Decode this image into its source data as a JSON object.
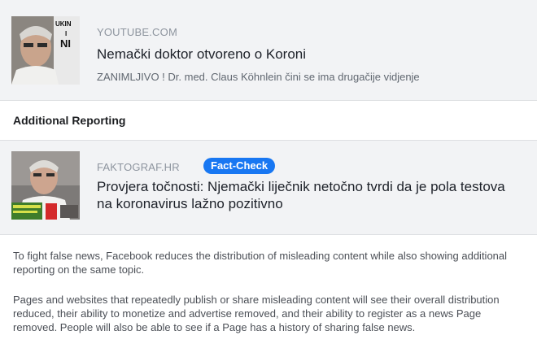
{
  "original_post": {
    "domain": "YOUTUBE.COM",
    "title": "Nemački doktor otvoreno o Koroni",
    "description": "ZANIMLJIVO ! Dr. med. Claus Köhnlein čini se ima drugačije vidjenje",
    "thumbnail_overlay": [
      "UKIN",
      "I",
      "NI"
    ]
  },
  "additional_reporting": {
    "heading": "Additional Reporting",
    "domain": "FAKTOGRAF.HR",
    "badge": "Fact-Check",
    "title": "Provjera točnosti: Njemački liječnik netočno tvrdi da je pola testova na koronavirus lažno pozitivno"
  },
  "notice": {
    "paragraph_1": "To fight false news, Facebook reduces the distribution of misleading content while also showing additional reporting on the same topic.",
    "paragraph_2": "Pages and websites that repeatedly publish or share misleading content will see their overall distribution reduced, their ability to monetize and advertise removed, and their ability to register as a news Page removed. People will also be able to see if a Page has a history of sharing false news."
  },
  "colors": {
    "badge": "#1877f2",
    "link_background": "#f2f3f5",
    "domain_text": "#8d949e"
  }
}
